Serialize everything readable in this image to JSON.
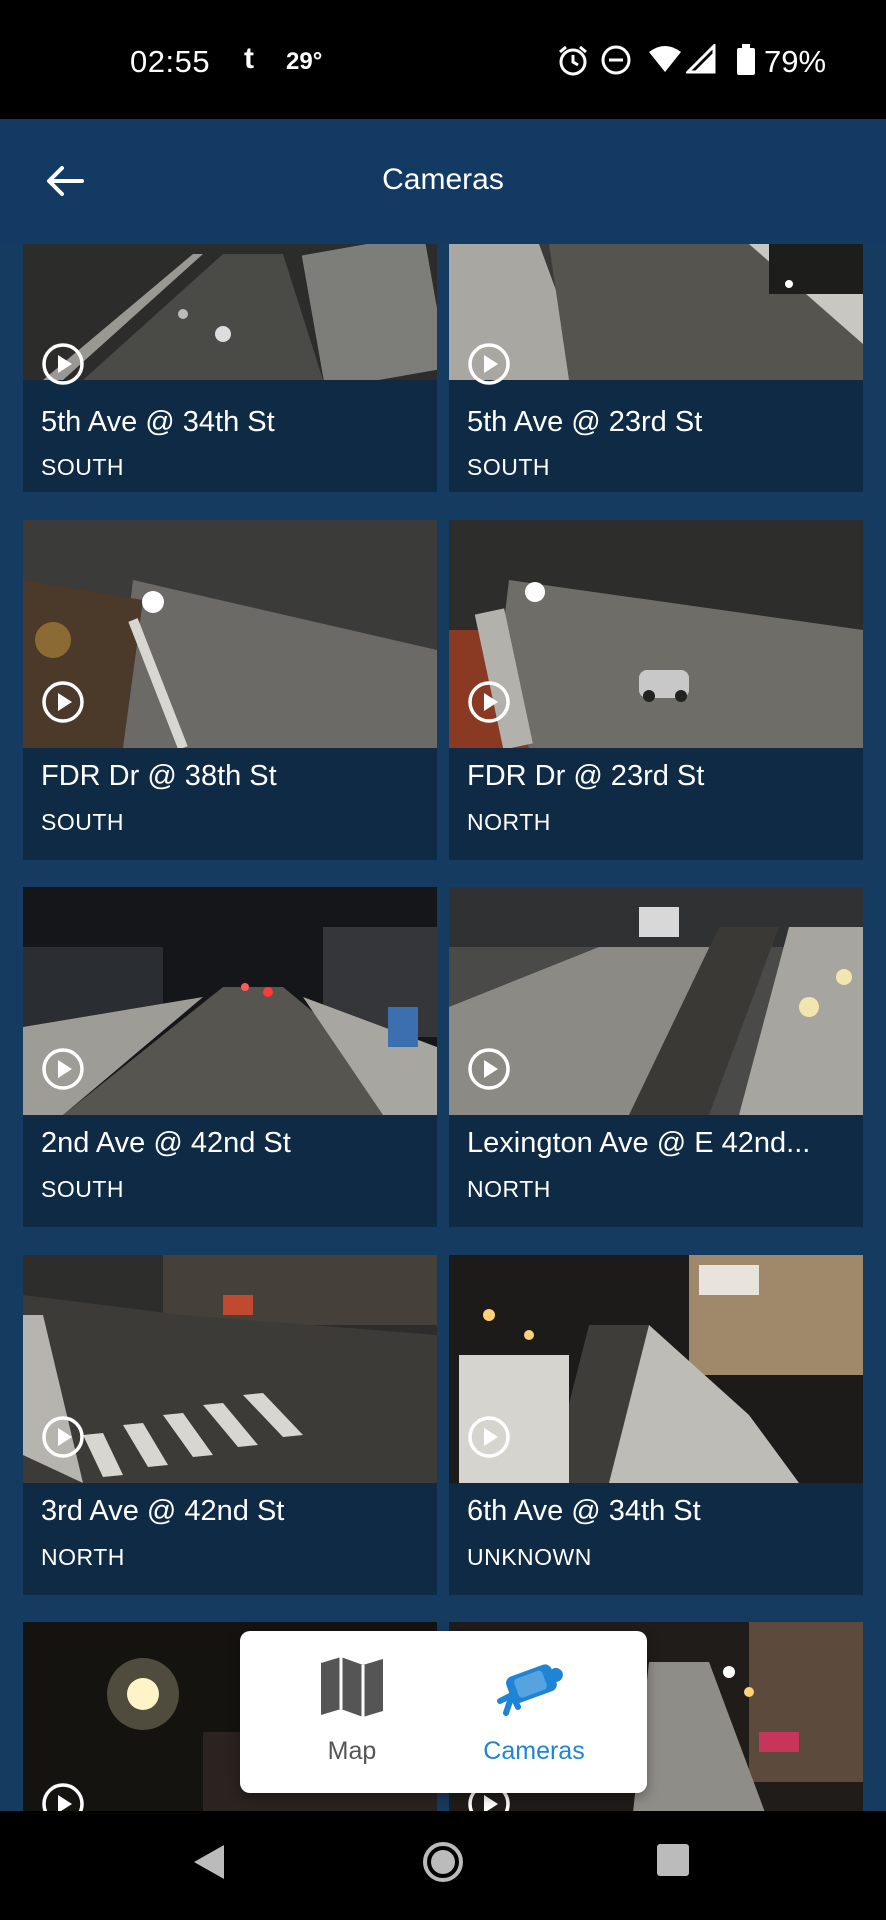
{
  "status_bar": {
    "time": "02:55",
    "notification_icon": "t",
    "temperature": "29°",
    "battery": "79%",
    "icons": [
      "alarm-icon",
      "do-not-disturb-icon",
      "wifi-icon",
      "signal-icon",
      "battery-icon"
    ]
  },
  "header": {
    "title": "Cameras",
    "back_icon": "arrow-left-icon"
  },
  "cameras": [
    {
      "name": "5th Ave @ 34th St",
      "direction": "SOUTH"
    },
    {
      "name": "5th Ave @ 23rd St",
      "direction": "SOUTH"
    },
    {
      "name": "FDR Dr @ 38th St",
      "direction": "SOUTH"
    },
    {
      "name": "FDR Dr @ 23rd St",
      "direction": "NORTH"
    },
    {
      "name": "2nd Ave @ 42nd St",
      "direction": "SOUTH"
    },
    {
      "name": "Lexington Ave @ E 42nd...",
      "direction": "NORTH"
    },
    {
      "name": "3rd Ave @ 42nd St",
      "direction": "NORTH"
    },
    {
      "name": "6th Ave @ 34th St",
      "direction": "UNKNOWN"
    }
  ],
  "tabs": [
    {
      "label": "Map",
      "icon": "map-icon",
      "active": false
    },
    {
      "label": "Cameras",
      "icon": "camera-icon",
      "active": true
    }
  ],
  "colors": {
    "header_bg": "#133a62",
    "content_bg": "#163b60",
    "card_bg": "#0f2a45",
    "active_tab": "#1f84d6"
  }
}
